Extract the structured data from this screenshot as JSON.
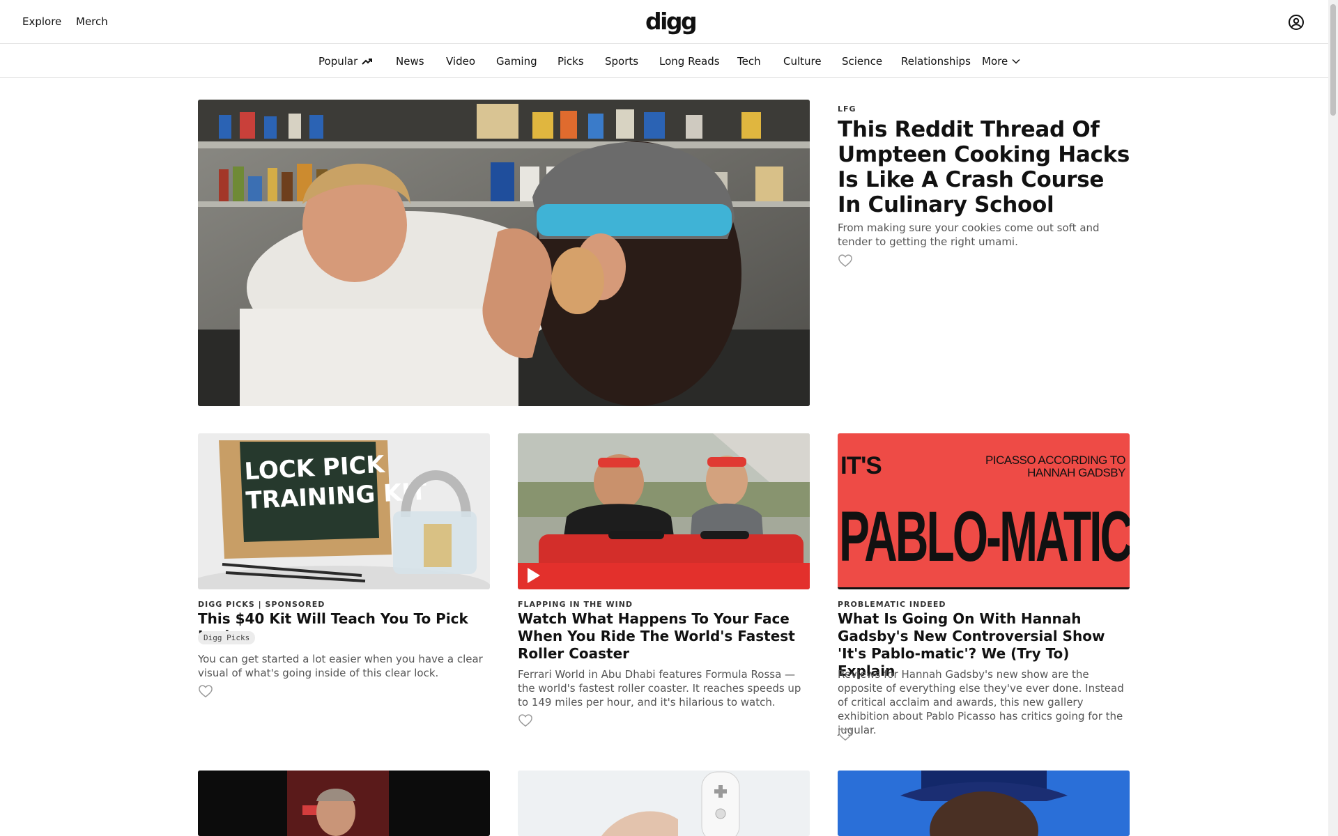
{
  "topbar": {
    "explore_label": "Explore",
    "merch_label": "Merch",
    "logo_text": "digg",
    "account_icon": "user-circle-icon"
  },
  "categories": [
    {
      "label": "Popular",
      "icon": "trending-up-icon"
    },
    {
      "label": "News"
    },
    {
      "label": "Video"
    },
    {
      "label": "Gaming"
    },
    {
      "label": "Picks"
    },
    {
      "label": "Sports"
    },
    {
      "label": "Long Reads"
    },
    {
      "label": "Tech"
    },
    {
      "label": "Culture"
    },
    {
      "label": "Science"
    },
    {
      "label": "Relationships"
    },
    {
      "label": "More",
      "icon": "chevron-down-icon"
    }
  ],
  "featured": {
    "kicker": "LFG",
    "headline": "This Reddit Thread Of Umpteen Cooking Hacks Is Like A Crash Course In Culinary School",
    "dek": "From making sure your cookies come out soft and tender to getting the right umami."
  },
  "cards": [
    {
      "kicker": "DIGG PICKS | SPONSORED",
      "headline": "This $40 Kit Will Teach You To Pick Locks",
      "tag": "Digg Picks",
      "dek": "You can get started a lot easier when you have a clear visual of what's going inside of this clear lock.",
      "image_text_line1": "LOCK PICK",
      "image_text_line2": "TRAINING KIT"
    },
    {
      "kicker": "FLAPPING IN THE WIND",
      "headline": "Watch What Happens To Your Face When You Ride The World's Fastest Roller Coaster",
      "dek": "Ferrari World in Abu Dhabi features Formula Rossa — the world's fastest roller coaster. It reaches speeds up to 149 miles per hour, and it's hilarious to watch.",
      "media_icon": "play-icon"
    },
    {
      "kicker": "PROBLEMATIC INDEED",
      "headline": "What Is Going On With Hannah Gadsby's New Controversial Show 'It's Pablo-matic'? We (Try To) Explain",
      "dek": "Reviews for Hannah Gadsby's new show are the opposite of everything else they've ever done. Instead of critical acclaim and awards, this new gallery exhibition about Pablo Picasso has critics going for the jugular.",
      "image_text_small": "IT'S",
      "image_text_big": "PABLO-MATIC",
      "image_text_top_right_1": "PICASSO ACCORDING TO",
      "image_text_top_right_2": "HANNAH GADSBY"
    }
  ],
  "colors": {
    "pablo_red": "#ee4b46",
    "box_green": "#26392d",
    "divider": "#e4e4e4"
  }
}
